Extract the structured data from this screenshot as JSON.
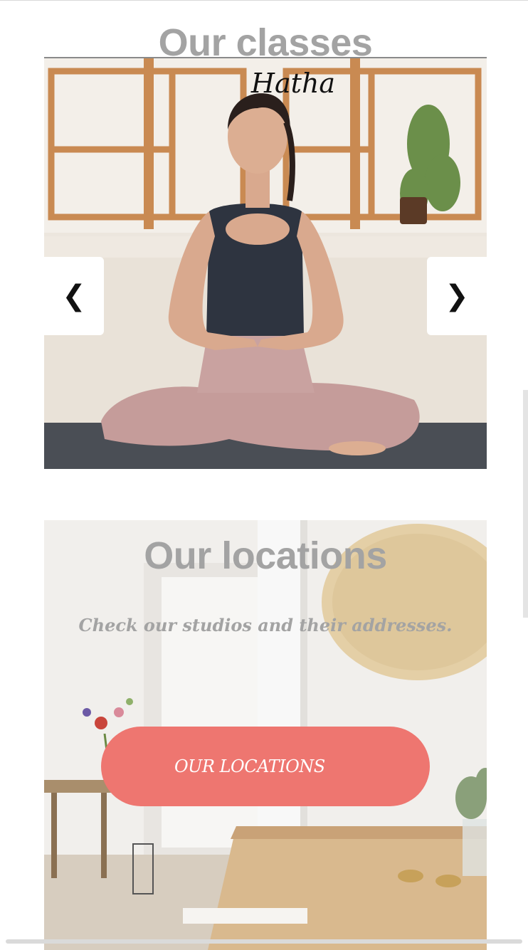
{
  "classes": {
    "title": "Our classes",
    "slide_caption": "Hatha",
    "prev_glyph": "❮",
    "next_glyph": "❯",
    "icons": {
      "prev": "chevron-left-icon",
      "next": "chevron-right-icon"
    }
  },
  "locations": {
    "title": "Our locations",
    "subtitle": "Check our studios and their addresses.",
    "button_label": "OUR LOCATIONS",
    "button_color": "#ee7670"
  }
}
